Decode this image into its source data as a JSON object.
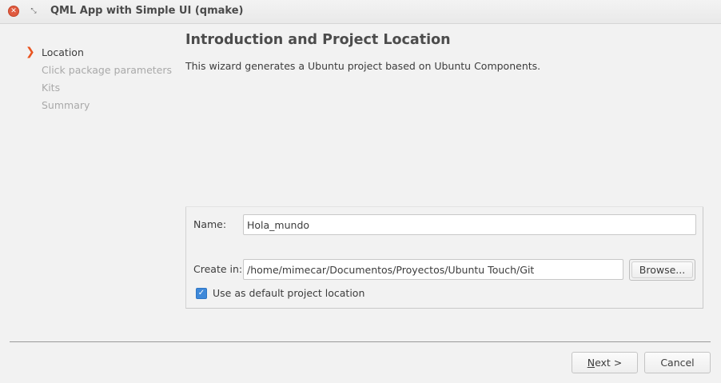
{
  "window": {
    "title": "QML App with Simple UI (qmake)",
    "close_glyph": "✕",
    "restore_glyph": "⤡"
  },
  "sidebar": {
    "current_marker": "❯",
    "steps": [
      {
        "label": "Location",
        "state": "current"
      },
      {
        "label": "Click package parameters",
        "state": "pending"
      },
      {
        "label": "Kits",
        "state": "pending"
      },
      {
        "label": "Summary",
        "state": "pending"
      }
    ]
  },
  "page": {
    "heading": "Introduction and Project Location",
    "description": "This wizard generates a Ubuntu project based on Ubuntu Components."
  },
  "form": {
    "name_label": "Name:",
    "name_value": "Hola_mundo",
    "create_in_label": "Create in:",
    "create_in_value": "/home/mimecar/Documentos/Proyectos/Ubuntu Touch/Git",
    "browse_label": "Browse...",
    "default_location_label": "Use as default project location",
    "default_location_checked": true,
    "check_glyph": "✓"
  },
  "footer": {
    "next_label": "Next >",
    "cancel_label": "Cancel"
  },
  "colors": {
    "accent_orange": "#e95420",
    "checkbox_blue": "#3f89d9",
    "close_red": "#e05b40"
  },
  "icons": {
    "close": "close-icon",
    "restore": "restore-icon",
    "current_step": "chevron-right-icon",
    "checkbox": "checkmark-icon"
  }
}
